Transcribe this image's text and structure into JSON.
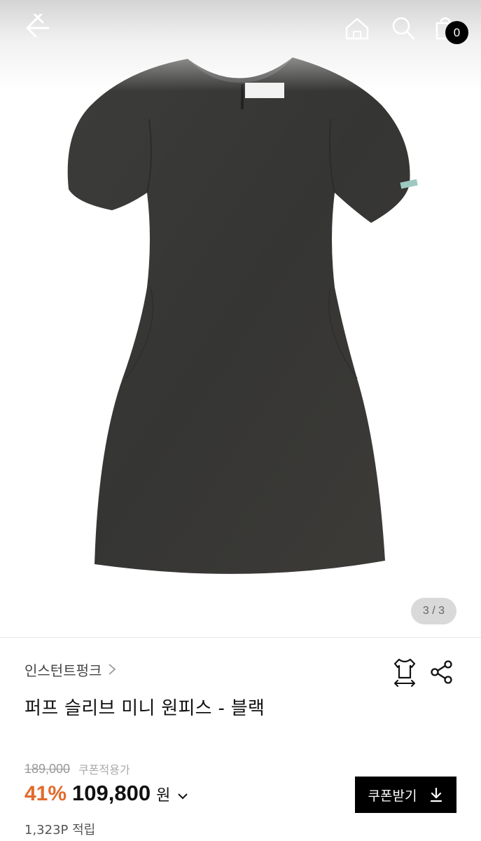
{
  "header": {
    "back_icon": "back-arrow-icon",
    "home_icon": "home-icon",
    "search_icon": "search-icon",
    "cart_icon": "cart-icon",
    "cart_count": "0"
  },
  "gallery": {
    "image_alt": "dress-image",
    "page_indicator": "3 / 3"
  },
  "product": {
    "brand": "인스턴트펑크",
    "title": "퍼프 슬리브 미니 원피스 - 블랙",
    "original_price": "189,000",
    "coupon_note": "쿠폰적용가",
    "discount": "41%",
    "price": "109,800",
    "currency": "원",
    "points": "1,323P 적립"
  },
  "actions": {
    "coupon_button": "쿠폰받기",
    "size_icon": "size-guide-icon",
    "share_icon": "share-icon"
  },
  "colors": {
    "discount": "#e26a2c",
    "button_bg": "#000000",
    "dress": "#3a3a38"
  }
}
